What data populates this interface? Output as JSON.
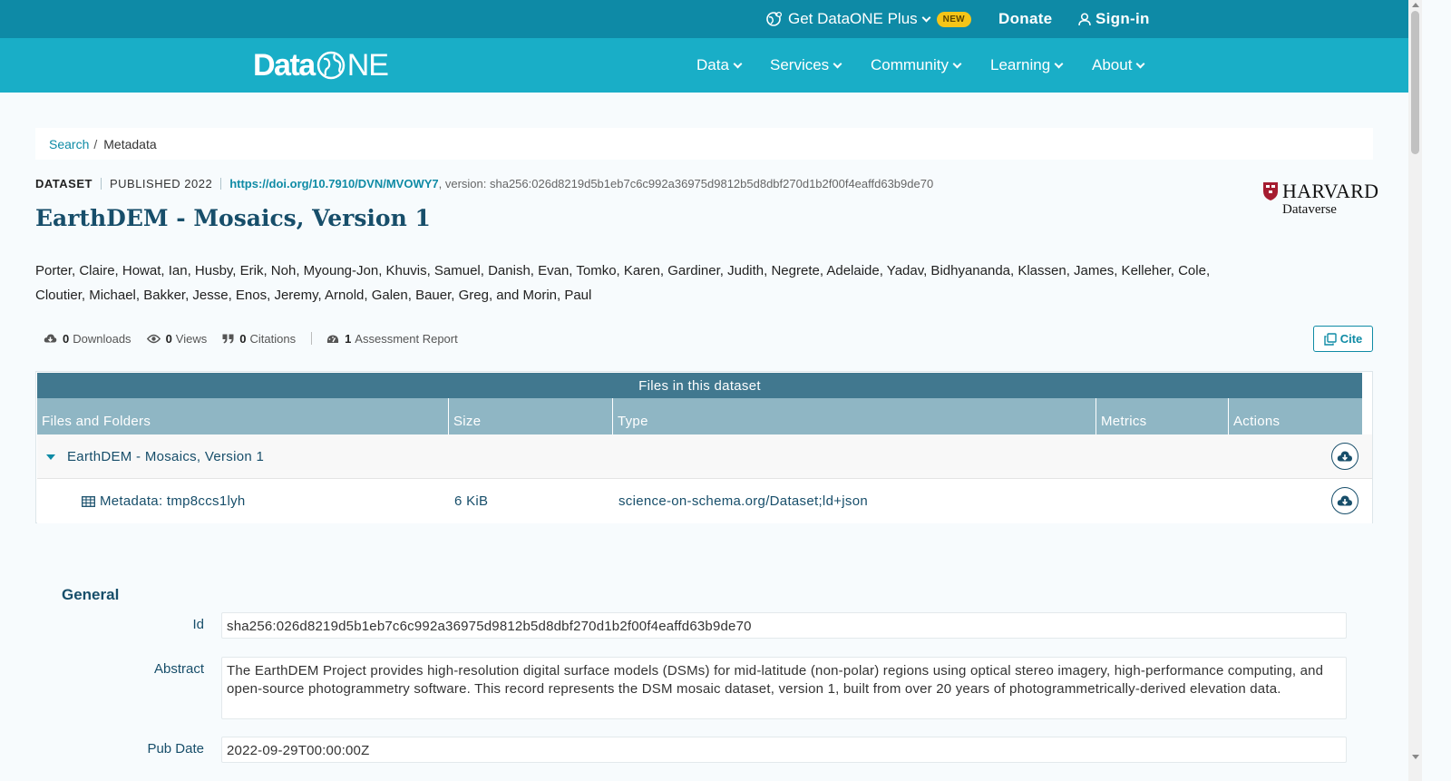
{
  "topbar": {
    "plus_label": "Get DataONE Plus",
    "plus_badge": "NEW",
    "donate": "Donate",
    "signin": "Sign-in"
  },
  "nav": {
    "logo_left": "Data",
    "logo_right": "NE",
    "items": [
      "Data",
      "Services",
      "Community",
      "Learning",
      "About"
    ]
  },
  "breadcrumb": {
    "search": "Search",
    "separator": "/",
    "current": "Metadata"
  },
  "dataset": {
    "type": "DATASET",
    "published": "PUBLISHED 2022",
    "doi": "https://doi.org/10.7910/DVN/MVOWY7",
    "version_text": ", version: sha256:026d8219d5b1eb7c6c992a36975d9812b5d8dbf270d1b2f00f4eaffd63b9de70",
    "title": "EarthDEM - Mosaics, Version 1",
    "repository_name": "HARVARD",
    "repository_sub": "Dataverse",
    "authors": "Porter, Claire, Howat, Ian, Husby, Erik, Noh, Myoung-Jon, Khuvis, Samuel, Danish, Evan, Tomko, Karen, Gardiner, Judith, Negrete, Adelaide, Yadav, Bidhyananda, Klassen, James, Kelleher, Cole, Cloutier, Michael, Bakker, Jesse, Enos, Jeremy, Arnold, Galen, Bauer, Greg, and Morin, Paul"
  },
  "stats": {
    "downloads_count": "0",
    "downloads_label": "Downloads",
    "views_count": "0",
    "views_label": "Views",
    "citations_count": "0",
    "citations_label": "Citations",
    "assessment_count": "1",
    "assessment_label": "Assessment Report",
    "cite_button": "Cite"
  },
  "files": {
    "header": "Files in this dataset",
    "columns": [
      "Files and Folders",
      "Size",
      "Type",
      "Metrics",
      "Actions"
    ],
    "folder_name": "EarthDEM - Mosaics, Version 1",
    "rows": [
      {
        "name": "Metadata: tmp8ccs1lyh",
        "size": "6 KiB",
        "type": "science-on-schema.org/Dataset;ld+json"
      }
    ]
  },
  "general": {
    "title": "General",
    "id_label": "Id",
    "id_value": "sha256:026d8219d5b1eb7c6c992a36975d9812b5d8dbf270d1b2f00f4eaffd63b9de70",
    "abstract_label": "Abstract",
    "abstract_value": "The EarthDEM Project provides high-resolution digital surface models (DSMs) for mid-latitude (non-polar) regions using optical stereo imagery, high-performance computing, and open-source photogrammetry software. This record represents the DSM mosaic dataset, version 1, built from over 20 years of photogrammetrically-derived elevation data.",
    "pubdate_label": "Pub Date",
    "pubdate_value": "2022-09-29T00:00:00Z"
  },
  "colors": {
    "topbar": "#0e8aa6",
    "navbar": "#19aec7",
    "accent": "#0f8ba5",
    "title": "#174e6a",
    "table_header": "#41788f",
    "table_columns": "#8fb6c4",
    "badge": "#f5c518"
  }
}
